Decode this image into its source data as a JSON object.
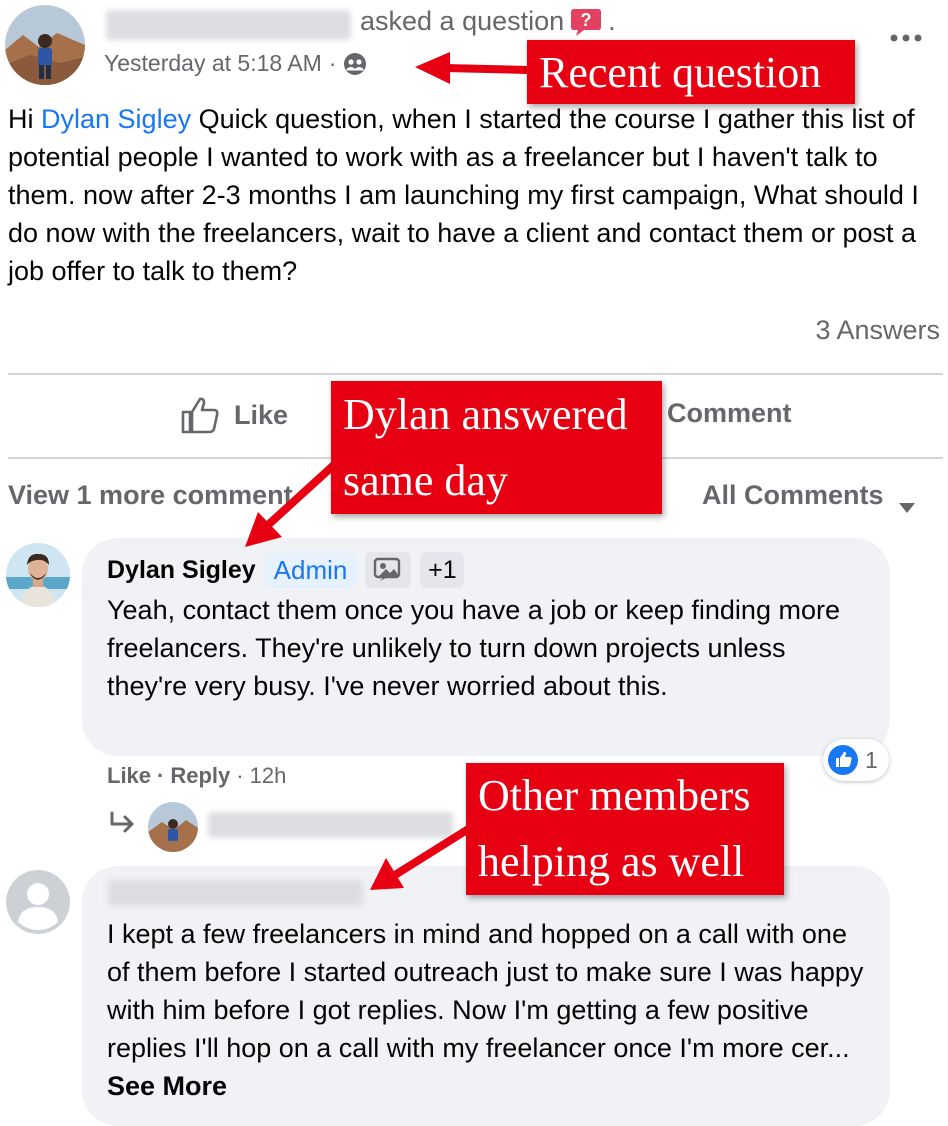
{
  "post": {
    "action_text": "asked a question",
    "timestamp": "Yesterday at 5:18 AM",
    "separator": "·",
    "greeting": "Hi",
    "mention": "Dylan Sigley",
    "body": "Quick question, when I started the course I gather this list of potential people I wanted to work with as a freelancer but I haven't talk to them. now after 2-3 months I am launching my first campaign, What should I do now with the freelancers, wait to have a client and contact them or post a job offer to talk to them?",
    "answers_count": "3 Answers",
    "icons": {
      "question": "question-mark-icon",
      "audience": "group-icon",
      "more": "more-options-icon"
    }
  },
  "actions": {
    "like": "Like",
    "comment": "Comment"
  },
  "comments_bar": {
    "view_more": "View 1 more comment",
    "filter": "All Comments"
  },
  "comments": [
    {
      "author": "Dylan Sigley",
      "badge": "Admin",
      "extra_badges": "+1",
      "text": "Yeah, contact them once you have a job or keep finding more freelancers. They're unlikely to turn down projects unless they're very busy. I've never worried about this.",
      "reaction_count": "1",
      "like": "Like",
      "reply": "Reply",
      "age": "12h",
      "dot": "·"
    },
    {
      "text": "I kept a few freelancers in mind and hopped on a call with one of them before I started outreach just to make sure I was happy with him before I got replies. Now I'm getting a few positive replies I'll hop on a call with my freelancer once I'm more cer...",
      "see_more": "See More"
    }
  ],
  "annotations": [
    {
      "text": "Recent question"
    },
    {
      "line1": "Dylan answered",
      "line2": "same day"
    },
    {
      "line1": "Other members",
      "line2": "helping as well"
    }
  ],
  "colors": {
    "callout": "#e60012",
    "link": "#1877f2",
    "bubble": "#f0f2f5",
    "muted": "#65676b"
  }
}
